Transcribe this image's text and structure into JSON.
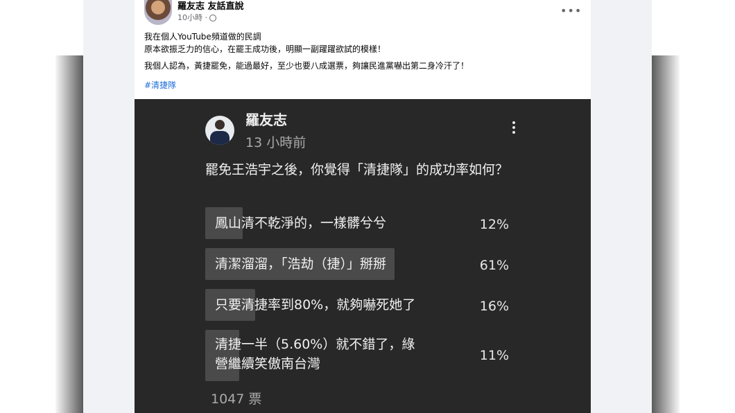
{
  "post": {
    "author": "羅友志 友話直說",
    "time": "10小時",
    "text_lines": [
      "我在個人YouTube頻道做的民調",
      "原本欲振乏力的信心，在罷王成功後，明顯一副躍躍欲試的模樣！",
      "我個人認為，黃捷罷免，能過最好，至少也要八成選票，夠讓民進黨嚇出第二身冷汗了！"
    ],
    "hashtag": "#清捷隊",
    "more_icon": "•••"
  },
  "poll": {
    "channel_name": "羅友志",
    "time_ago": "13 小時前",
    "question": "罷免王浩宇之後，你覺得「清捷隊」的成功率如何？",
    "options": [
      {
        "label_lines": [
          "鳳山清不乾淨的，一樣髒兮兮"
        ],
        "percent_text": "12%",
        "percent": 12
      },
      {
        "label_lines": [
          "清潔溜溜，「浩劫（捷）」掰掰"
        ],
        "percent_text": "61%",
        "percent": 61
      },
      {
        "label_lines": [
          "只要清捷率到80%，就夠嚇死她了"
        ],
        "percent_text": "16%",
        "percent": 16
      },
      {
        "label_lines": [
          "清捷一半（5.60%）就不錯了，綠",
          "營繼續笑傲南台灣"
        ],
        "percent_text": "11%",
        "percent": 11
      }
    ],
    "votes": "1047 票"
  }
}
